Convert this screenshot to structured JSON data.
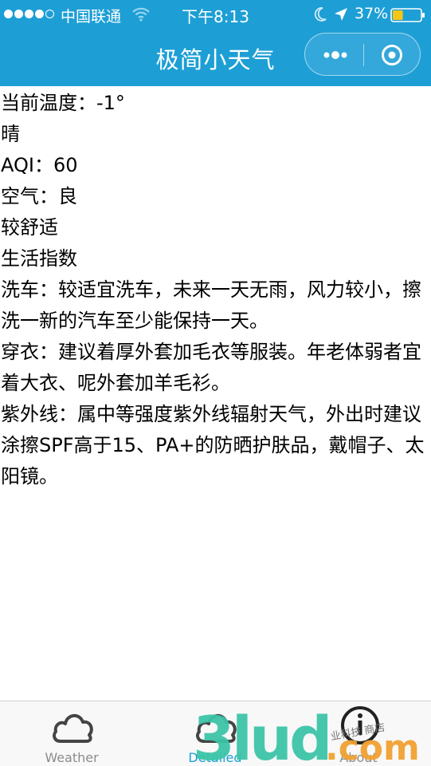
{
  "status_bar": {
    "carrier": "中国联通",
    "time": "下午8:13",
    "battery_percent": "37%",
    "battery_level": 0.37,
    "signal_bars": 4,
    "signal_max": 5
  },
  "nav": {
    "title": "极简小天气"
  },
  "weather": {
    "temperature": "当前温度：-1°",
    "condition": "晴",
    "aqi": "AQI：60",
    "air_quality": "空气：良",
    "comfort": "较舒适",
    "life_index_heading": "生活指数",
    "car_wash": "洗车：较适宜洗车，未来一天无雨，风力较小，擦洗一新的汽车至少能保持一天。",
    "dressing": "穿衣：建议着厚外套加毛衣等服装。年老体弱者宜着大衣、呢外套加羊毛衫。",
    "uv": "紫外线：属中等强度紫外线辐射天气，外出时建议涂擦SPF高于15、PA+的防晒护肤品，戴帽子、太阳镜。"
  },
  "tabs": [
    {
      "label": "Weather",
      "icon": "cloud-icon",
      "active": false
    },
    {
      "label": "Detailed",
      "icon": "cloud-icon",
      "active": true
    },
    {
      "label": "About",
      "icon": "info-icon",
      "active": false
    }
  ],
  "watermark": {
    "brand": "3lud.com",
    "script": "业科技 商店"
  },
  "colors": {
    "nav_background": "#1d9fd6",
    "active_tab": "#1d9fd6",
    "inactive_tab": "#8c8c8c",
    "battery": "#f5c518",
    "watermark_green": "#3cc4a8",
    "watermark_orange": "#f0a030"
  }
}
